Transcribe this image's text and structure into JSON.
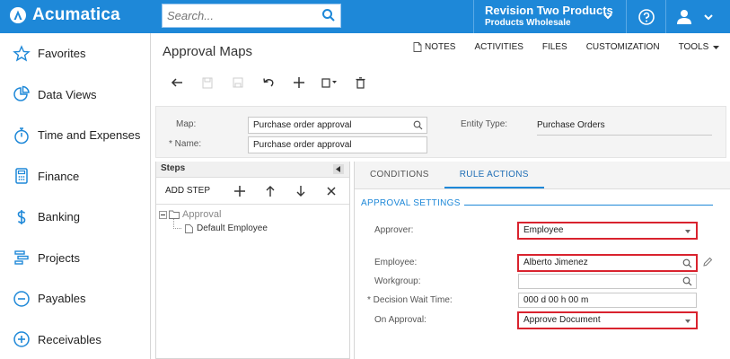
{
  "app": {
    "brand": "Acumatica"
  },
  "search": {
    "placeholder": "Search..."
  },
  "tenant": {
    "company": "Revision Two Products",
    "branch": "Products Wholesale"
  },
  "sidebar": {
    "items": [
      {
        "label": "Favorites",
        "icon": "star-icon"
      },
      {
        "label": "Data Views",
        "icon": "pie-chart-icon"
      },
      {
        "label": "Time and Expenses",
        "icon": "stopwatch-icon"
      },
      {
        "label": "Finance",
        "icon": "calculator-icon"
      },
      {
        "label": "Banking",
        "icon": "dollar-icon"
      },
      {
        "label": "Projects",
        "icon": "projects-icon"
      },
      {
        "label": "Payables",
        "icon": "minus-circle-icon"
      },
      {
        "label": "Receivables",
        "icon": "plus-circle-icon"
      }
    ]
  },
  "page": {
    "title": "Approval Maps"
  },
  "toplinks": {
    "notes": "NOTES",
    "activities": "ACTIVITIES",
    "files": "FILES",
    "customization": "CUSTOMIZATION",
    "tools": "TOOLS"
  },
  "form": {
    "map_label": "Map:",
    "map_value": "Purchase order approval",
    "name_label": "* Name:",
    "name_value": "Purchase order approval",
    "entity_type_label": "Entity Type:",
    "entity_type_value": "Purchase Orders"
  },
  "steps": {
    "header": "Steps",
    "add_step": "ADD STEP",
    "tree_root": "Approval",
    "tree_child": "Default Employee"
  },
  "tabs": [
    {
      "label": "CONDITIONS"
    },
    {
      "label": "RULE ACTIONS"
    }
  ],
  "approval_settings": {
    "section_title": "APPROVAL SETTINGS",
    "approver_label": "Approver:",
    "approver_value": "Employee",
    "employee_label": "Employee:",
    "employee_value": "Alberto Jimenez",
    "workgroup_label": "Workgroup:",
    "workgroup_value": "",
    "wait_time_label": "* Decision Wait Time:",
    "wait_time_value": "000 d 00 h 00 m",
    "on_approval_label": "On Approval:",
    "on_approval_value": "Approve Document"
  },
  "colors": {
    "topbar": "#1e88d8",
    "highlight": "#d9232e",
    "accent": "#1e88d8"
  }
}
